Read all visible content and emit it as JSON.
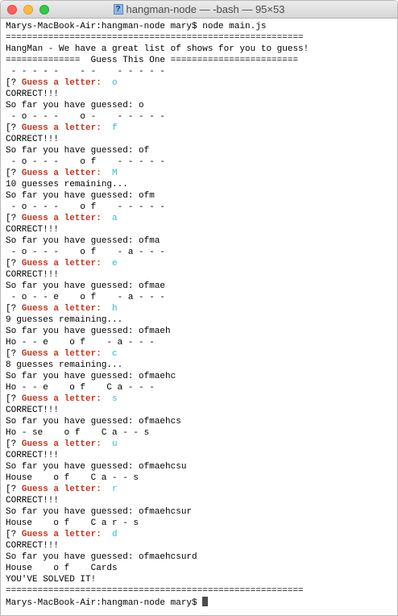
{
  "window": {
    "title": "hangman-node — -bash — 95×53",
    "title_icon": "?"
  },
  "terminal": {
    "command_line": "Marys-MacBook-Air:hangman-node mary$ node main.js",
    "divider": "========================================================",
    "intro": "HangMan - We have a great list of shows for you to guess!",
    "subtitle": "==============  Guess This One ========================",
    "initial_board": " - - - - -    - -    - - - - -",
    "prompt_prefix": "[? ",
    "prompt_label": "Guess a letter:",
    "rounds": [
      {
        "guess": "o",
        "lines": [
          "CORRECT!!!",
          "So far you have guessed: o",
          " - o - - -    o -    - - - - -"
        ]
      },
      {
        "guess": "f",
        "lines": [
          "CORRECT!!!",
          "So far you have guessed: of",
          " - o - - -    o f    - - - - -"
        ]
      },
      {
        "guess": "M",
        "lines": [
          "10 guesses remaining...",
          "So far you have guessed: ofm",
          " - o - - -    o f    - - - - -"
        ]
      },
      {
        "guess": "a",
        "lines": [
          "CORRECT!!!",
          "So far you have guessed: ofma",
          " - o - - -    o f    - a - - -"
        ]
      },
      {
        "guess": "e",
        "lines": [
          "CORRECT!!!",
          "So far you have guessed: ofmae",
          " - o - - e    o f    - a - - -"
        ]
      },
      {
        "guess": "h",
        "lines": [
          "9 guesses remaining...",
          "So far you have guessed: ofmaeh",
          "Ho - - e    o f    - a - - -"
        ]
      },
      {
        "guess": "c",
        "lines": [
          "8 guesses remaining...",
          "So far you have guessed: ofmaehc",
          "Ho - - e    o f    C a - - -"
        ]
      },
      {
        "guess": "s",
        "lines": [
          "CORRECT!!!",
          "So far you have guessed: ofmaehcs",
          "Ho - se    o f    C a - - s"
        ]
      },
      {
        "guess": "u",
        "lines": [
          "CORRECT!!!",
          "So far you have guessed: ofmaehcsu",
          "House    o f    C a - - s"
        ]
      },
      {
        "guess": "r",
        "lines": [
          "CORRECT!!!",
          "So far you have guessed: ofmaehcsur",
          "House    o f    C a r - s"
        ]
      },
      {
        "guess": "d",
        "lines": [
          "CORRECT!!!",
          "So far you have guessed: ofmaehcsurd",
          "House    o f    Cards"
        ]
      }
    ],
    "solved": "YOU'VE SOLVED IT!",
    "final_divider": "========================================================",
    "final_prompt": "Marys-MacBook-Air:hangman-node mary$ "
  },
  "colors": {
    "prompt_label": "#c23621",
    "guess": "#33bbc8"
  }
}
